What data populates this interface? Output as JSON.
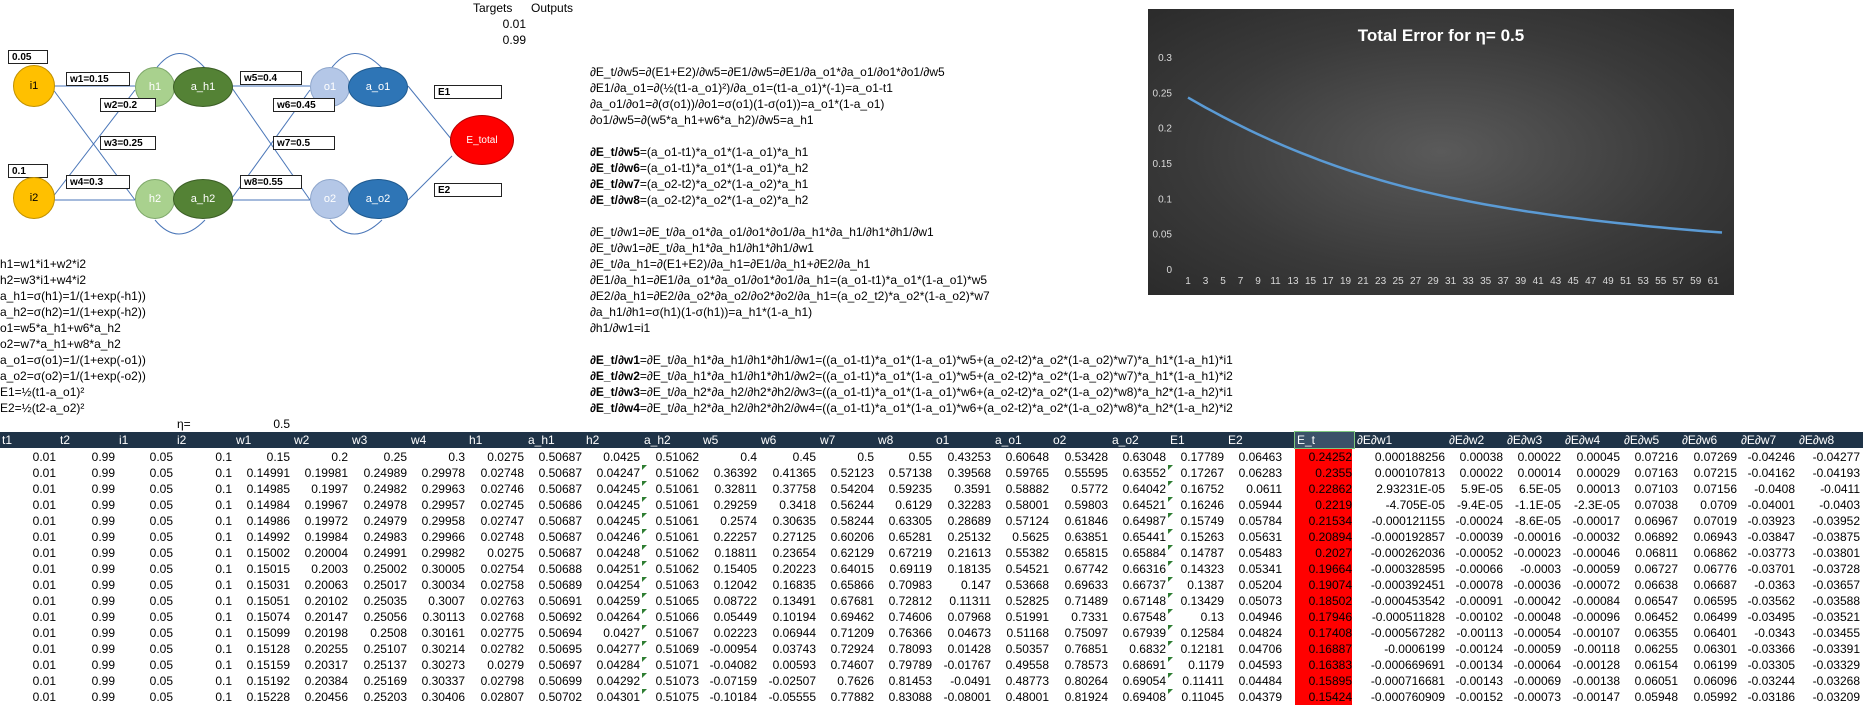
{
  "top": {
    "targets_label": "Targets",
    "outputs_label": "Outputs",
    "target1": "0.01",
    "target2": "0.99"
  },
  "network": {
    "input1_value": "0.05",
    "input2_value": "0.1",
    "i1": "i1",
    "i2": "i2",
    "h1": "h1",
    "h2": "h2",
    "a_h1": "a_h1",
    "a_h2": "a_h2",
    "o1": "o1",
    "o2": "o2",
    "a_o1": "a_o1",
    "a_o2": "a_o2",
    "e_total": "E_total",
    "e1": "E1",
    "e2": "E2",
    "w1": "w1=0.15",
    "w2": "w2=0.2",
    "w3": "w3=0.25",
    "w4": "w4=0.3",
    "w5": "w5=0.4",
    "w6": "w6=0.45",
    "w7": "w7=0.5",
    "w8": "w8=0.55"
  },
  "formulas": [
    "h1=w1*i1+w2*i2",
    "h2=w3*i1+w4*i2",
    "a_h1=σ(h1)=1/(1+exp(-h1))",
    "a_h2=σ(h2)=1/(1+exp(-h2))",
    "o1=w5*a_h1+w6*a_h2",
    "o2=w7*a_h1+w8*a_h2",
    "a_o1=σ(o1)=1/(1+exp(-o1))",
    "a_o2=σ(o2)=1/(1+exp(-o2))",
    "E1=½(t1-a_o1)²",
    "E2=½(t2-a_o2)²"
  ],
  "eta": {
    "label": "η=",
    "value": "0.5"
  },
  "derivations": {
    "block1": [
      "∂E_t/∂w5=∂(E1+E2)/∂w5=∂E1/∂w5=∂E1/∂a_o1*∂a_o1/∂o1*∂o1/∂w5",
      "∂E1/∂a_o1=∂(½(t1-a_o1)²)/∂a_o1=(t1-a_o1)*(-1)=a_o1-t1",
      "∂a_o1/∂o1=∂(σ(o1))/∂o1=σ(o1)(1-σ(o1))=a_o1*(1-a_o1)",
      "∂o1/∂w5=∂(w5*a_h1+w6*a_h2)/∂w5=a_h1"
    ],
    "block2": [
      {
        "lhs": "∂E_t/∂w5",
        "rhs": "=(a_o1-t1)*a_o1*(1-a_o1)*a_h1"
      },
      {
        "lhs": "∂E_t/∂w6",
        "rhs": "=(a_o1-t1)*a_o1*(1-a_o1)*a_h2"
      },
      {
        "lhs": "∂E_t/∂w7",
        "rhs": "=(a_o2-t2)*a_o2*(1-a_o2)*a_h1"
      },
      {
        "lhs": "∂E_t/∂w8",
        "rhs": "=(a_o2-t2)*a_o2*(1-a_o2)*a_h2"
      }
    ],
    "block3": [
      "∂E_t/∂w1=∂E_t/∂a_o1*∂a_o1/∂o1*∂o1/∂a_h1*∂a_h1/∂h1*∂h1/∂w1",
      "∂E_t/∂w1=∂E_t/∂a_h1*∂a_h1/∂h1*∂h1/∂w1",
      "∂E_t/∂a_h1=∂(E1+E2)/∂a_h1=∂E1/∂a_h1+∂E2/∂a_h1",
      "∂E1/∂a_h1=∂E1/∂a_o1*∂a_o1/∂o1*∂o1/∂a_h1=(a_o1-t1)*a_o1*(1-a_o1)*w5",
      "∂E2/∂a_h1=∂E2/∂a_o2*∂a_o2/∂o2*∂o2/∂a_h1=(a_o2_t2)*a_o2*(1-a_o2)*w7",
      "∂a_h1/∂h1=σ(h1)(1-σ(h1))=a_h1*(1-a_h1)",
      "∂h1/∂w1=i1"
    ],
    "block4": [
      {
        "lhs": "∂E_t/∂w1",
        "rhs": "=∂E_t/∂a_h1*∂a_h1/∂h1*∂h1/∂w1=((a_o1-t1)*a_o1*(1-a_o1)*w5+(a_o2-t2)*a_o2*(1-a_o2)*w7)*a_h1*(1-a_h1)*i1"
      },
      {
        "lhs": "∂E_t/∂w2",
        "rhs": "=∂E_t/∂a_h1*∂a_h1/∂h1*∂h1/∂w2=((a_o1-t1)*a_o1*(1-a_o1)*w5+(a_o2-t2)*a_o2*(1-a_o2)*w7)*a_h1*(1-a_h1)*i2"
      },
      {
        "lhs": "∂E_t/∂w3",
        "rhs": "=∂E_t/∂a_h2*∂a_h2/∂h2*∂h2/∂w3=((a_o1-t1)*a_o1*(1-a_o1)*w6+(a_o2-t2)*a_o2*(1-a_o2)*w8)*a_h2*(1-a_h2)*i1"
      },
      {
        "lhs": "∂E_t/∂w4",
        "rhs": "=∂E_t/∂a_h2*∂a_h2/∂h2*∂h2/∂w4=((a_o1-t1)*a_o1*(1-a_o1)*w6+(a_o2-t2)*a_o2*(1-a_o2)*w8)*a_h2*(1-a_h2)*i2"
      }
    ]
  },
  "table": {
    "headers": [
      "t1",
      "t2",
      "i1",
      "i2",
      "w1",
      "w2",
      "w3",
      "w4",
      "h1",
      "a_h1",
      "h2",
      "a_h2",
      "w5",
      "w6",
      "w7",
      "w8",
      "o1",
      "a_o1",
      "o2",
      "a_o2",
      "E1",
      "E2",
      "E_t",
      "∂E∂w1",
      "∂E∂w2",
      "∂E∂w3",
      "∂E∂w4",
      "∂E∂w5",
      "∂E∂w6",
      "∂E∂w7",
      "∂E∂w8"
    ],
    "rows": [
      [
        "0.01",
        "0.99",
        "0.05",
        "0.1",
        "0.15",
        "0.2",
        "0.25",
        "0.3",
        "0.0275",
        "0.50687",
        "0.0425",
        "0.51062",
        "0.4",
        "0.45",
        "0.5",
        "0.55",
        "0.43253",
        "0.60648",
        "0.53428",
        "0.63048",
        "0.17789",
        "0.06463",
        "0.24252",
        "0.000188256",
        "0.00038",
        "0.00022",
        "0.00045",
        "0.07216",
        "0.07269",
        "-0.04246",
        "-0.04277"
      ],
      [
        "0.01",
        "0.99",
        "0.05",
        "0.1",
        "0.14991",
        "0.19981",
        "0.24989",
        "0.29978",
        "0.02748",
        "0.50687",
        "0.04247",
        "0.51062",
        "0.36392",
        "0.41365",
        "0.52123",
        "0.57138",
        "0.39568",
        "0.59765",
        "0.55595",
        "0.63552",
        "0.17267",
        "0.06283",
        "0.2355",
        "0.000107813",
        "0.00022",
        "0.00014",
        "0.00029",
        "0.07163",
        "0.07215",
        "-0.04162",
        "-0.04193"
      ],
      [
        "0.01",
        "0.99",
        "0.05",
        "0.1",
        "0.14985",
        "0.1997",
        "0.24982",
        "0.29963",
        "0.02746",
        "0.50687",
        "0.04245",
        "0.51061",
        "0.32811",
        "0.37758",
        "0.54204",
        "0.59235",
        "0.3591",
        "0.58882",
        "0.5772",
        "0.64042",
        "0.16752",
        "0.0611",
        "0.22862",
        "2.93231E-05",
        "5.9E-05",
        "6.5E-05",
        "0.00013",
        "0.07103",
        "0.07156",
        "-0.0408",
        "-0.0411"
      ],
      [
        "0.01",
        "0.99",
        "0.05",
        "0.1",
        "0.14984",
        "0.19967",
        "0.24978",
        "0.29957",
        "0.02745",
        "0.50686",
        "0.04245",
        "0.51061",
        "0.29259",
        "0.3418",
        "0.56244",
        "0.6129",
        "0.32283",
        "0.58001",
        "0.59803",
        "0.64521",
        "0.16246",
        "0.05944",
        "0.2219",
        "-4.705E-05",
        "-9.4E-05",
        "-1.1E-05",
        "-2.3E-05",
        "0.07038",
        "0.0709",
        "-0.04001",
        "-0.0403"
      ],
      [
        "0.01",
        "0.99",
        "0.05",
        "0.1",
        "0.14986",
        "0.19972",
        "0.24979",
        "0.29958",
        "0.02747",
        "0.50687",
        "0.04245",
        "0.51061",
        "0.2574",
        "0.30635",
        "0.58244",
        "0.63305",
        "0.28689",
        "0.57124",
        "0.61846",
        "0.64987",
        "0.15749",
        "0.05784",
        "0.21534",
        "-0.000121155",
        "-0.00024",
        "-8.6E-05",
        "-0.00017",
        "0.06967",
        "0.07019",
        "-0.03923",
        "-0.03952"
      ],
      [
        "0.01",
        "0.99",
        "0.05",
        "0.1",
        "0.14992",
        "0.19984",
        "0.24983",
        "0.29966",
        "0.02748",
        "0.50687",
        "0.04246",
        "0.51061",
        "0.22257",
        "0.27125",
        "0.60206",
        "0.65281",
        "0.25132",
        "0.5625",
        "0.63851",
        "0.65441",
        "0.15263",
        "0.05631",
        "0.20894",
        "-0.000192857",
        "-0.00039",
        "-0.00016",
        "-0.00032",
        "0.06892",
        "0.06943",
        "-0.03847",
        "-0.03875"
      ],
      [
        "0.01",
        "0.99",
        "0.05",
        "0.1",
        "0.15002",
        "0.20004",
        "0.24991",
        "0.29982",
        "0.0275",
        "0.50687",
        "0.04248",
        "0.51062",
        "0.18811",
        "0.23654",
        "0.62129",
        "0.67219",
        "0.21613",
        "0.55382",
        "0.65815",
        "0.65884",
        "0.14787",
        "0.05483",
        "0.2027",
        "-0.000262036",
        "-0.00052",
        "-0.00023",
        "-0.00046",
        "0.06811",
        "0.06862",
        "-0.03773",
        "-0.03801"
      ],
      [
        "0.01",
        "0.99",
        "0.05",
        "0.1",
        "0.15015",
        "0.2003",
        "0.25002",
        "0.30005",
        "0.02754",
        "0.50688",
        "0.04251",
        "0.51062",
        "0.15405",
        "0.20223",
        "0.64015",
        "0.69119",
        "0.18135",
        "0.54521",
        "0.67742",
        "0.66316",
        "0.14323",
        "0.05341",
        "0.19664",
        "-0.000328595",
        "-0.00066",
        "-0.0003",
        "-0.00059",
        "0.06727",
        "0.06776",
        "-0.03701",
        "-0.03728"
      ],
      [
        "0.01",
        "0.99",
        "0.05",
        "0.1",
        "0.15031",
        "0.20063",
        "0.25017",
        "0.30034",
        "0.02758",
        "0.50689",
        "0.04254",
        "0.51063",
        "0.12042",
        "0.16835",
        "0.65866",
        "0.70983",
        "0.147",
        "0.53668",
        "0.69633",
        "0.66737",
        "0.1387",
        "0.05204",
        "0.19074",
        "-0.000392451",
        "-0.00078",
        "-0.00036",
        "-0.00072",
        "0.06638",
        "0.06687",
        "-0.0363",
        "-0.03657"
      ],
      [
        "0.01",
        "0.99",
        "0.05",
        "0.1",
        "0.15051",
        "0.20102",
        "0.25035",
        "0.3007",
        "0.02763",
        "0.50691",
        "0.04259",
        "0.51065",
        "0.08722",
        "0.13491",
        "0.67681",
        "0.72812",
        "0.11311",
        "0.52825",
        "0.71489",
        "0.67148",
        "0.13429",
        "0.05073",
        "0.18502",
        "-0.000453542",
        "-0.00091",
        "-0.00042",
        "-0.00084",
        "0.06547",
        "0.06595",
        "-0.03562",
        "-0.03588"
      ],
      [
        "0.01",
        "0.99",
        "0.05",
        "0.1",
        "0.15074",
        "0.20147",
        "0.25056",
        "0.30113",
        "0.02768",
        "0.50692",
        "0.04264",
        "0.51066",
        "0.05449",
        "0.10194",
        "0.69462",
        "0.74606",
        "0.07968",
        "0.51991",
        "0.7331",
        "0.67548",
        "0.13",
        "0.04946",
        "0.17946",
        "-0.000511828",
        "-0.00102",
        "-0.00048",
        "-0.00096",
        "0.06452",
        "0.06499",
        "-0.03495",
        "-0.03521"
      ],
      [
        "0.01",
        "0.99",
        "0.05",
        "0.1",
        "0.15099",
        "0.20198",
        "0.2508",
        "0.30161",
        "0.02775",
        "0.50694",
        "0.0427",
        "0.51067",
        "0.02223",
        "0.06944",
        "0.71209",
        "0.76366",
        "0.04673",
        "0.51168",
        "0.75097",
        "0.67939",
        "0.12584",
        "0.04824",
        "0.17408",
        "-0.000567282",
        "-0.00113",
        "-0.00054",
        "-0.00107",
        "0.06355",
        "0.06401",
        "-0.0343",
        "-0.03455"
      ],
      [
        "0.01",
        "0.99",
        "0.05",
        "0.1",
        "0.15128",
        "0.20255",
        "0.25107",
        "0.30214",
        "0.02782",
        "0.50695",
        "0.04277",
        "0.51069",
        "-0.00954",
        "0.03743",
        "0.72924",
        "0.78093",
        "0.01428",
        "0.50357",
        "0.76851",
        "0.6832",
        "0.12181",
        "0.04706",
        "0.16887",
        "-0.0006199",
        "-0.00124",
        "-0.00059",
        "-0.00118",
        "0.06255",
        "0.06301",
        "-0.03366",
        "-0.03391"
      ],
      [
        "0.01",
        "0.99",
        "0.05",
        "0.1",
        "0.15159",
        "0.20317",
        "0.25137",
        "0.30273",
        "0.0279",
        "0.50697",
        "0.04284",
        "0.51071",
        "-0.04082",
        "0.00593",
        "0.74607",
        "0.79789",
        "-0.01767",
        "0.49558",
        "0.78573",
        "0.68691",
        "0.1179",
        "0.04593",
        "0.16383",
        "-0.000669691",
        "-0.00134",
        "-0.00064",
        "-0.00128",
        "0.06154",
        "0.06199",
        "-0.03305",
        "-0.03329"
      ],
      [
        "0.01",
        "0.99",
        "0.05",
        "0.1",
        "0.15192",
        "0.20384",
        "0.25169",
        "0.30337",
        "0.02798",
        "0.50699",
        "0.04292",
        "0.51073",
        "-0.07159",
        "-0.02507",
        "0.7626",
        "0.81453",
        "-0.0491",
        "0.48773",
        "0.80264",
        "0.69054",
        "0.11411",
        "0.04484",
        "0.15895",
        "-0.000716681",
        "-0.00143",
        "-0.00069",
        "-0.00138",
        "0.06051",
        "0.06096",
        "-0.03244",
        "-0.03268"
      ],
      [
        "0.01",
        "0.99",
        "0.05",
        "0.1",
        "0.15228",
        "0.20456",
        "0.25203",
        "0.30406",
        "0.02807",
        "0.50702",
        "0.04301",
        "0.51075",
        "-0.10184",
        "-0.05555",
        "0.77882",
        "0.83088",
        "-0.08001",
        "0.48001",
        "0.81924",
        "0.69408",
        "0.11045",
        "0.04379",
        "0.15424",
        "-0.000760909",
        "-0.00152",
        "-0.00073",
        "-0.00147",
        "0.05948",
        "0.05992",
        "-0.03186",
        "-0.03209"
      ]
    ]
  },
  "chart_data": {
    "type": "line",
    "title": "Total Error for η= 0.5",
    "x_tick_labels": [
      "1",
      "3",
      "5",
      "7",
      "9",
      "11",
      "13",
      "15",
      "17",
      "19",
      "21",
      "23",
      "25",
      "27",
      "29",
      "31",
      "33",
      "35",
      "37",
      "39",
      "41",
      "43",
      "45",
      "47",
      "49",
      "51",
      "53",
      "55",
      "57",
      "59",
      "61"
    ],
    "xlim": [
      1,
      62
    ],
    "ylim": [
      0,
      0.3
    ],
    "y_ticks": [
      "0",
      "0.05",
      "0.1",
      "0.15",
      "0.2",
      "0.25",
      "0.3"
    ],
    "grid": false,
    "legend": "none",
    "line_color": "#5b9bd5",
    "x": [
      1,
      2,
      3,
      4,
      5,
      6,
      7,
      8,
      9,
      10,
      11,
      12,
      13,
      14,
      15,
      16,
      17,
      18,
      19,
      20,
      21,
      22,
      23,
      24,
      25,
      26,
      27,
      28,
      29,
      30,
      31,
      32,
      33,
      34,
      35,
      36,
      37,
      38,
      39,
      40,
      41,
      42,
      43,
      44,
      45,
      46,
      47,
      48,
      49,
      50,
      51,
      52,
      53,
      54,
      55,
      56,
      57,
      58,
      59,
      60,
      61,
      62
    ],
    "values": [
      0.2425,
      0.2355,
      0.2286,
      0.2219,
      0.2153,
      0.2089,
      0.2027,
      0.1966,
      0.1907,
      0.185,
      0.1795,
      0.1741,
      0.1689,
      0.1638,
      0.159,
      0.1542,
      0.1497,
      0.1453,
      0.1411,
      0.137,
      0.1331,
      0.1293,
      0.1256,
      0.1221,
      0.1187,
      0.1155,
      0.1124,
      0.1094,
      0.1065,
      0.1037,
      0.101,
      0.0985,
      0.096,
      0.0936,
      0.0913,
      0.0891,
      0.087,
      0.0849,
      0.0829,
      0.081,
      0.0792,
      0.0774,
      0.0757,
      0.074,
      0.0724,
      0.0709,
      0.0694,
      0.0679,
      0.0665,
      0.0651,
      0.0638,
      0.0625,
      0.0612,
      0.06,
      0.0588,
      0.0577,
      0.0566,
      0.0555,
      0.0545,
      0.0535,
      0.0525,
      0.0516
    ]
  },
  "colors": {
    "input": "#ffc000",
    "hidden_in": "#a9d18e",
    "hidden_out": "#548235",
    "output_in": "#b4c7e7",
    "output_out": "#2e75b6",
    "error": "#ff0000",
    "header_bar": "#1f3347",
    "highlight": "#ff0000"
  }
}
